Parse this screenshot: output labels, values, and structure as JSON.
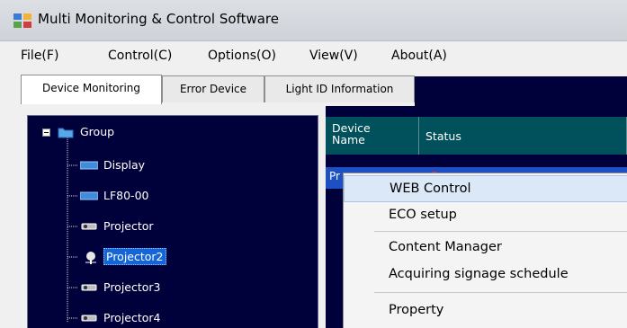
{
  "window": {
    "title": "Multi Monitoring & Control Software"
  },
  "menu": [
    "File(F)",
    "Control(C)",
    "Options(O)",
    "View(V)",
    "About(A)"
  ],
  "tabs": [
    "Device Monitoring",
    "Error Device",
    "Light ID Information"
  ],
  "tree": {
    "root": "Group",
    "children": [
      "Display",
      "LF80-00",
      "Projector",
      "Projector2",
      "Projector3",
      "Projector4"
    ],
    "selected": "Projector2"
  },
  "device_list": {
    "columns": [
      "Device\nName",
      "Status"
    ],
    "first_row_partial": "Pr"
  },
  "context_menu": {
    "items": [
      "WEB Control",
      "ECO setup",
      "Content Manager",
      "Acquiring signage schedule",
      "Property"
    ],
    "highlighted": "WEB Control"
  },
  "colors": {
    "panel_bg": "#00003b",
    "highlight": "#1466d8",
    "header_bg": "#00515b"
  }
}
